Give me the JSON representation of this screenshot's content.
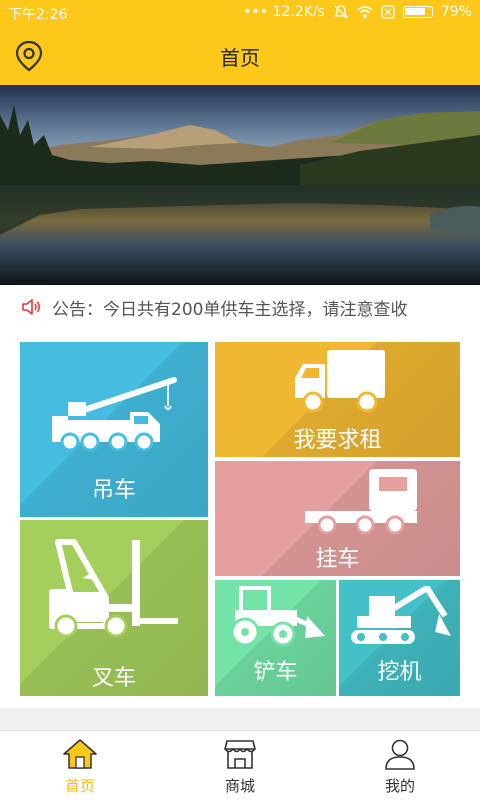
{
  "status_bar": {
    "time": "下午2:26",
    "indicators": "•••  12.2K/s",
    "battery": "79%",
    "battery_level": 0.79
  },
  "header": {
    "title": "首页",
    "left_icon": "location-pin-icon"
  },
  "banner": {
    "image": "mountain-lake-landscape",
    "page_count": 2,
    "active_page": 2
  },
  "notice": {
    "icon": "speaker-icon",
    "text": "公告：今日共有200单供车主选择，请注意查收"
  },
  "categories": [
    {
      "label": "吊车",
      "icon": "crane-truck-icon",
      "color": "#44bde0"
    },
    {
      "label": "我要求租",
      "icon": "box-truck-icon",
      "color": "#f0b832"
    },
    {
      "label": "挂车",
      "icon": "trailer-truck-icon",
      "color": "#e59f9f"
    },
    {
      "label": "叉车",
      "icon": "forklift-icon",
      "color": "#a5cf5d"
    },
    {
      "label": "铲车",
      "icon": "wheel-loader-icon",
      "color": "#73e3a7"
    },
    {
      "label": "挖机",
      "icon": "excavator-icon",
      "color": "#44c0c8"
    }
  ],
  "tabbar": {
    "items": [
      {
        "label": "首页",
        "icon": "home-icon",
        "active": true
      },
      {
        "label": "商城",
        "icon": "shop-icon",
        "active": false
      },
      {
        "label": "我的",
        "icon": "user-icon",
        "active": false
      }
    ],
    "active_color": "#f3bd17"
  },
  "colors": {
    "brand": "#fdc819"
  }
}
